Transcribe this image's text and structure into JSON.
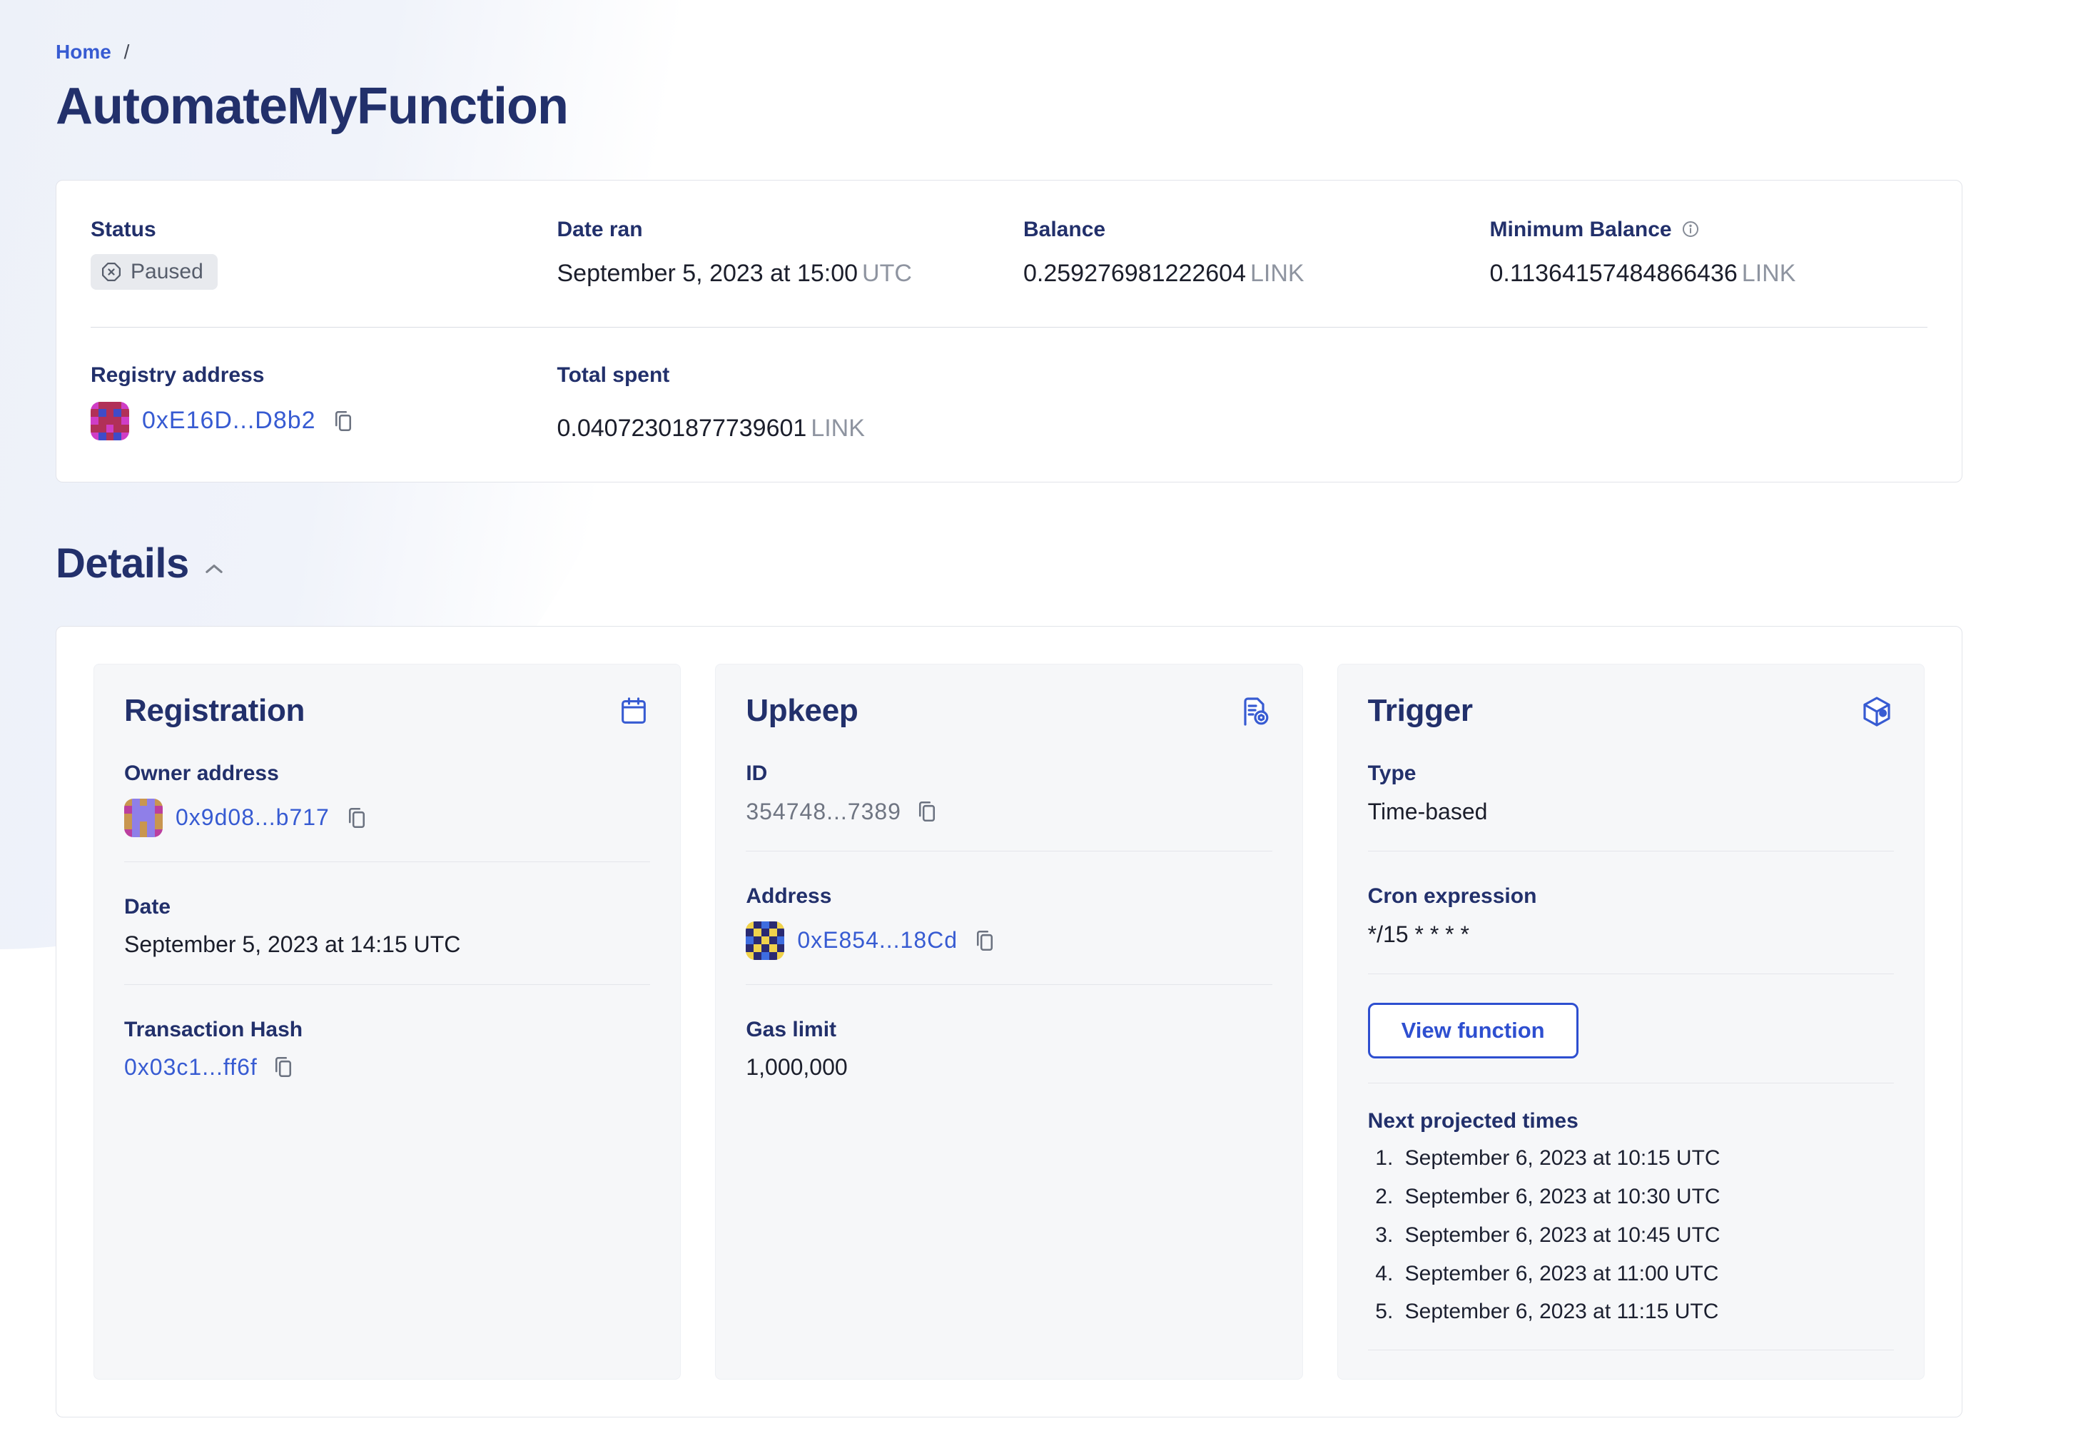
{
  "colors": {
    "accent": "#375bd2",
    "heading": "#22306b",
    "text": "#1b1e2b",
    "muted": "#8e94a0",
    "badge_bg": "#e8eaee",
    "badge_text": "#565d6b",
    "panel_bg": "#f6f7f9",
    "card_border": "#e2e4ea",
    "blob": "#edf1f9"
  },
  "breadcrumb": {
    "home_label": "Home",
    "separator": "/"
  },
  "page_title": "AutomateMyFunction",
  "summary": {
    "status": {
      "label": "Status",
      "badge": "Paused"
    },
    "date_ran": {
      "label": "Date ran",
      "value": "September 5, 2023 at 15:00",
      "suffix": "UTC"
    },
    "balance": {
      "label": "Balance",
      "value": "0.259276981222604",
      "suffix": "LINK"
    },
    "min_balance": {
      "label": "Minimum Balance",
      "value": "0.11364157484866436",
      "suffix": "LINK"
    },
    "registry": {
      "label": "Registry address",
      "address": "0xE16D...D8b2"
    },
    "total_spent": {
      "label": "Total spent",
      "value": "0.04072301877739601",
      "suffix": "LINK"
    }
  },
  "details": {
    "title": "Details"
  },
  "registration": {
    "title": "Registration",
    "owner": {
      "label": "Owner address",
      "address": "0x9d08...b717"
    },
    "date": {
      "label": "Date",
      "value": "September 5, 2023 at 14:15 UTC"
    },
    "tx": {
      "label": "Transaction Hash",
      "value": "0x03c1...ff6f"
    }
  },
  "upkeep": {
    "title": "Upkeep",
    "id": {
      "label": "ID",
      "value": "354748...7389"
    },
    "address": {
      "label": "Address",
      "value": "0xE854...18Cd"
    },
    "gas": {
      "label": "Gas limit",
      "value": "1,000,000"
    }
  },
  "trigger": {
    "title": "Trigger",
    "type": {
      "label": "Type",
      "value": "Time-based"
    },
    "cron": {
      "label": "Cron expression",
      "value": "*/15 * * * *"
    },
    "button_label": "View function",
    "next_label": "Next projected times",
    "next_times": [
      "September 6, 2023 at 10:15 UTC",
      "September 6, 2023 at 10:30 UTC",
      "September 6, 2023 at 10:45 UTC",
      "September 6, 2023 at 11:00 UTC",
      "September 6, 2023 at 11:15 UTC"
    ]
  },
  "identicons": {
    "registry": {
      "palette": {
        "M": "#cf3dc6",
        "C": "#b13058",
        "B": "#3f4bc9"
      },
      "rows": [
        "MCCCM",
        "CBCBC",
        "MCCCM",
        "CCMCC",
        "MBCBM"
      ]
    },
    "owner": {
      "palette": {
        "T": "#c9964f",
        "P": "#8f7fe8",
        "M": "#bb3f9e"
      },
      "rows": [
        "TPTPT",
        "MPPPM",
        "TPPPT",
        "TPTPT",
        "MPTPM"
      ]
    },
    "upkeep": {
      "palette": {
        "N": "#2a2a72",
        "Y": "#f0d24b",
        "B": "#3e6de0"
      },
      "rows": [
        "YNBNY",
        "NYNYN",
        "BNYNB",
        "NYNYN",
        "YNBNY"
      ]
    }
  }
}
